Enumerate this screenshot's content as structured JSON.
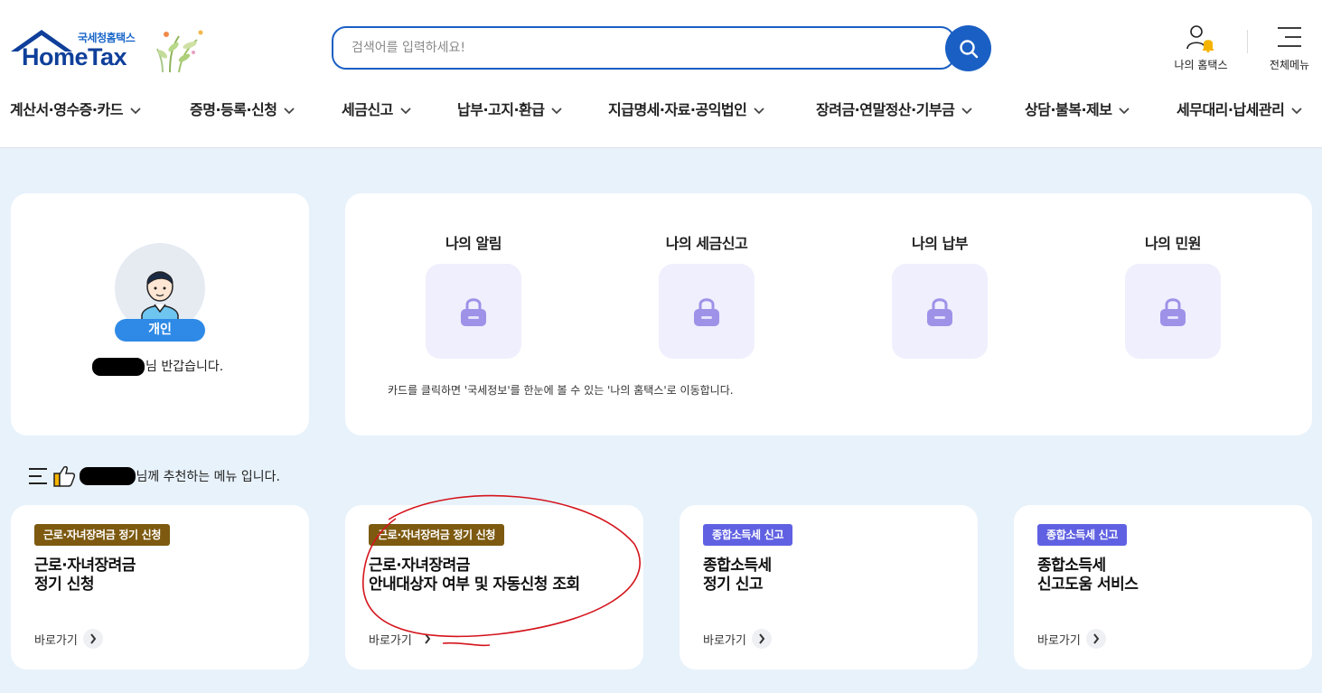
{
  "header": {
    "logo_sub": "국세청홈택스",
    "logo_main": "HomeTax",
    "search_placeholder": "검색어를 입력하세요!",
    "my_hometax": "나의 홈택스",
    "all_menu": "전체메뉴"
  },
  "nav": [
    {
      "label": "계산서·영수증·카드"
    },
    {
      "label": "증명·등록·신청"
    },
    {
      "label": "세금신고"
    },
    {
      "label": "납부·고지·환급"
    },
    {
      "label": "지급명세·자료·공익법인"
    },
    {
      "label": "장려금·연말정산·기부금"
    },
    {
      "label": "상담·불복·제보"
    },
    {
      "label": "세무대리·납세관리"
    }
  ],
  "profile": {
    "badge": "개인",
    "greeting_suffix": "님 반갑습니다."
  },
  "my_section": {
    "items": [
      {
        "title": "나의 알림"
      },
      {
        "title": "나의 세금신고"
      },
      {
        "title": "나의 납부"
      },
      {
        "title": "나의 민원"
      }
    ],
    "note": "카드를 클릭하면 '국세정보'를 한눈에 볼 수 있는 '나의 홈택스'로 이동합니다."
  },
  "recommend": {
    "suffix": "님께 추천하는 메뉴 입니다."
  },
  "menu_cards": [
    {
      "tag": "근로·자녀장려금 정기 신청",
      "title_line1": "근로·자녀장려금",
      "title_line2": "정기 신청",
      "link": "바로가기"
    },
    {
      "tag": "근로·자녀장려금 정기 신청",
      "title_line1": "근로·자녀장려금",
      "title_line2": "안내대상자 여부 및 자동신청 조회",
      "link": "바로가기"
    },
    {
      "tag": "종합소득세 신고",
      "title_line1": "종합소득세",
      "title_line2": "정기 신고",
      "link": "바로가기"
    },
    {
      "tag": "종합소득세 신고",
      "title_line1": "종합소득세",
      "title_line2": "신고도움 서비스",
      "link": "바로가기"
    }
  ],
  "colors": {
    "brand_blue": "#1a5fc4",
    "badge_blue": "#2e8ae6",
    "tag_brown": "#7d5a10",
    "tag_purple": "#6061e2",
    "page_bg": "#e8f2fb",
    "annotation_red": "#d4141c"
  }
}
